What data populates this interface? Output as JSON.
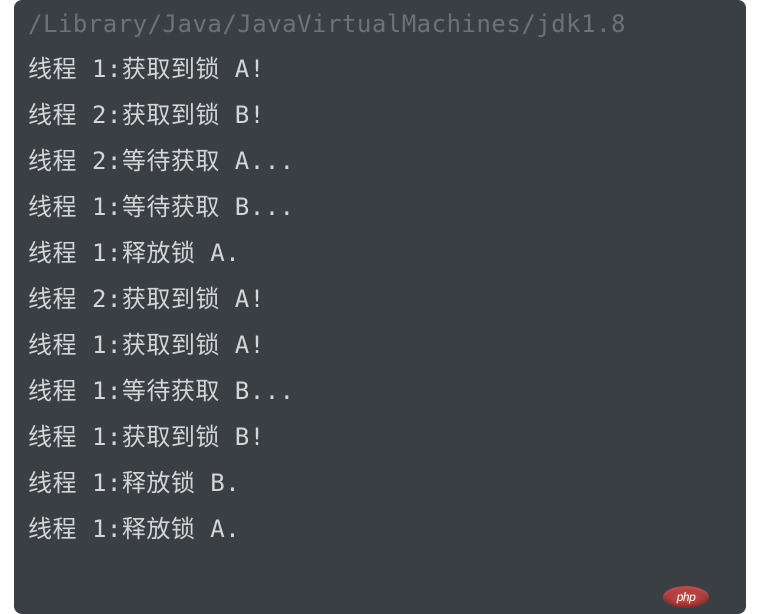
{
  "terminal": {
    "path": "/Library/Java/JavaVirtualMachines/jdk1.8",
    "lines": [
      "线程 1:获取到锁 A!",
      "线程 2:获取到锁 B!",
      "线程 2:等待获取 A...",
      "线程 1:等待获取 B...",
      "线程 1:释放锁 A.",
      "线程 2:获取到锁 A!",
      "线程 1:获取到锁 A!",
      "线程 1:等待获取 B...",
      "线程 1:获取到锁 B!",
      "线程 1:释放锁 B.",
      "线程 1:释放锁 A."
    ]
  },
  "watermark": {
    "text": "php",
    "tail": ""
  }
}
